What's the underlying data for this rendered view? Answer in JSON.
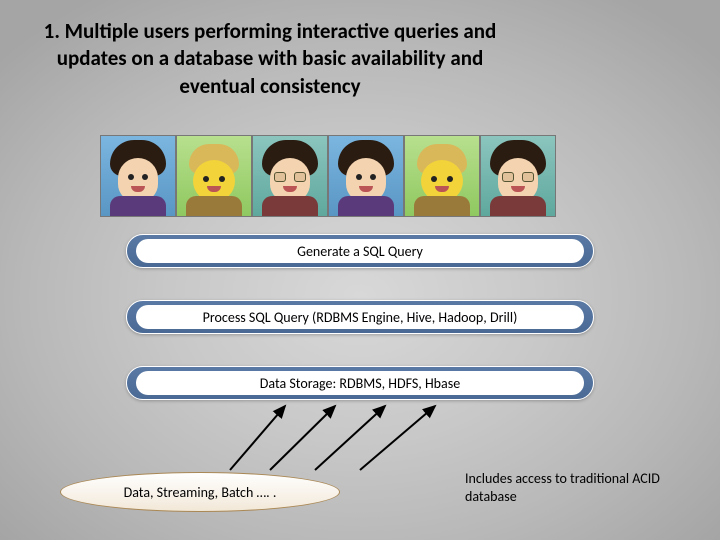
{
  "title": "1. Multiple users performing interactive queries and updates on a database with basic availability and eventual consistency",
  "layers": {
    "l1": "Generate a SQL Query",
    "l2": "Process SQL Query (RDBMS Engine, Hive, Hadoop, Drill)",
    "l3": "Data Storage: RDBMS, HDFS, Hbase"
  },
  "source": "Data, Streaming, Batch ….  .",
  "note": "Includes access to traditional ACID database"
}
